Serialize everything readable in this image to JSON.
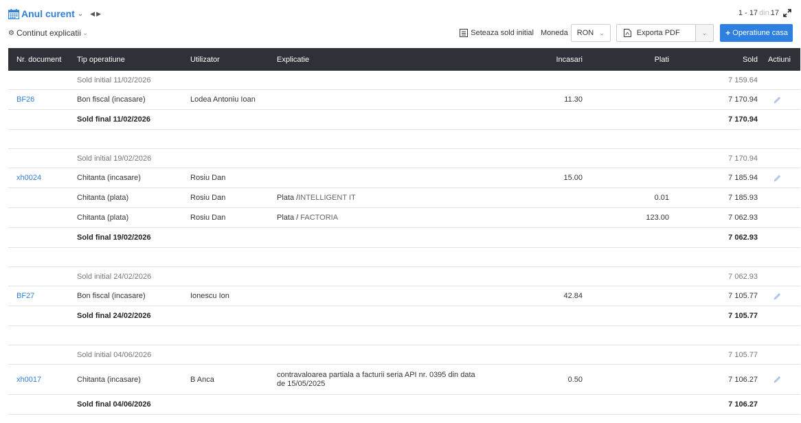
{
  "header": {
    "period_label": "Anul curent",
    "pager": {
      "from": "1",
      "to": "17",
      "of_label": "din",
      "total": "17"
    },
    "content_toggle_label": "Continut explicatii",
    "set_initial_label": "Seteaza sold initial",
    "currency_label": "Moneda",
    "currency_value": "RON",
    "export_label": "Exporta PDF",
    "new_op_label": "Operatiune casa",
    "accent_color": "#2d7fe0"
  },
  "table": {
    "columns": {
      "doc": "Nr. document",
      "tip": "Tip operatiune",
      "usr": "Utilizator",
      "exp": "Explicatie",
      "inc": "Incasari",
      "pla": "Plati",
      "sold": "Sold",
      "act": "Actiuni"
    },
    "groups": [
      {
        "initial": {
          "label": "Sold initial 11/02/2026",
          "sold": "7 159.64"
        },
        "rows": [
          {
            "doc": "BF26",
            "tip": "Bon fiscal (incasare)",
            "usr": "Lodea Antoniu Ioan",
            "exp": "",
            "party": "",
            "inc": "11.30",
            "pla": "",
            "sold": "7 170.94",
            "edit": true
          }
        ],
        "final": {
          "label": "Sold final 11/02/2026",
          "sold": "7 170.94"
        }
      },
      {
        "initial": {
          "label": "Sold initial 19/02/2026",
          "sold": "7 170.94"
        },
        "rows": [
          {
            "doc": "xh0024",
            "tip": "Chitanta (incasare)",
            "usr": "Rosiu Dan",
            "exp": "",
            "party": "",
            "inc": "15.00",
            "pla": "",
            "sold": "7 185.94",
            "edit": true
          },
          {
            "doc": "",
            "tip": "Chitanta (plata)",
            "usr": "Rosiu Dan",
            "exp": "Plata /",
            "party": "INTELLIGENT IT",
            "inc": "",
            "pla": "0.01",
            "sold": "7 185.93",
            "edit": false
          },
          {
            "doc": "",
            "tip": "Chitanta (plata)",
            "usr": "Rosiu Dan",
            "exp": "Plata / ",
            "party": "FACTORIA",
            "inc": "",
            "pla": "123.00",
            "sold": "7 062.93",
            "edit": false
          }
        ],
        "final": {
          "label": "Sold final 19/02/2026",
          "sold": "7 062.93"
        }
      },
      {
        "initial": {
          "label": "Sold initial 24/02/2026",
          "sold": "7 062.93"
        },
        "rows": [
          {
            "doc": "BF27",
            "tip": "Bon fiscal (incasare)",
            "usr": "Ionescu Ion",
            "exp": "",
            "party": "",
            "inc": "42.84",
            "pla": "",
            "sold": "7 105.77",
            "edit": true
          }
        ],
        "final": {
          "label": "Sold final 24/02/2026",
          "sold": "7 105.77"
        }
      },
      {
        "initial": {
          "label": "Sold initial 04/06/2026",
          "sold": "7 105.77"
        },
        "rows": [
          {
            "doc": "xh0017",
            "tip": "Chitanta (incasare)",
            "usr": "B Anca",
            "exp": "contravaloarea partiala a facturii seria API nr. 0395 din data de 15/05/2025",
            "party": "",
            "inc": "0.50",
            "pla": "",
            "sold": "7 106.27",
            "edit": true,
            "tall": true
          }
        ],
        "final": {
          "label": "Sold final 04/06/2026",
          "sold": "7 106.27"
        }
      }
    ]
  }
}
